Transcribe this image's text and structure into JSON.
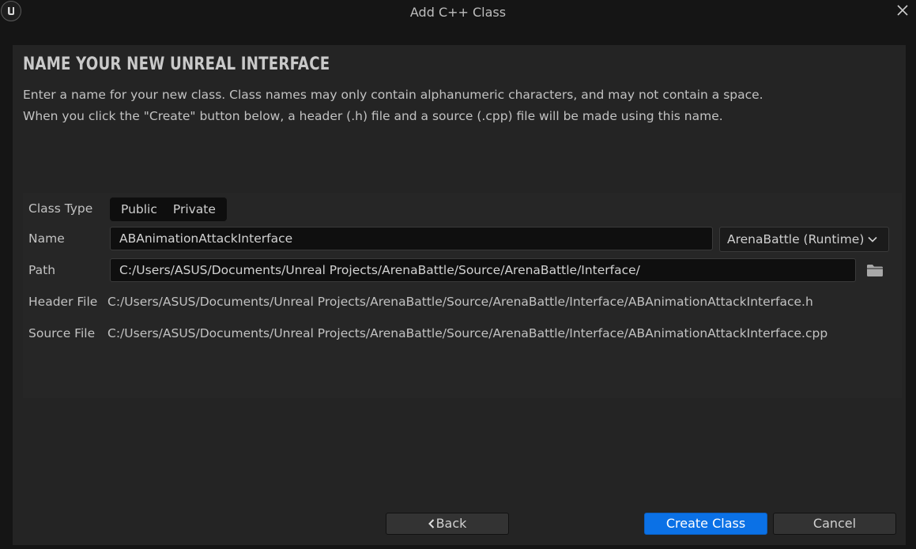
{
  "window": {
    "title": "Add C++ Class"
  },
  "header": {
    "title": "NAME YOUR NEW UNREAL INTERFACE",
    "description_line1": "Enter a name for your new class. Class names may only contain alphanumeric characters, and may not contain a space.",
    "description_line2": "When you click the \"Create\" button below, a header (.h) file and a source (.cpp) file will be made using this name."
  },
  "form": {
    "class_type_label": "Class Type",
    "class_type_options": [
      "Public",
      "Private"
    ],
    "name_label": "Name",
    "name_value": "ABAnimationAttackInterface",
    "module_selected": "ArenaBattle (Runtime)",
    "path_label": "Path",
    "path_value": "C:/Users/ASUS/Documents/Unreal Projects/ArenaBattle/Source/ArenaBattle/Interface/",
    "header_file_label": "Header File",
    "header_file_value": "C:/Users/ASUS/Documents/Unreal Projects/ArenaBattle/Source/ArenaBattle/Interface/ABAnimationAttackInterface.h",
    "source_file_label": "Source File",
    "source_file_value": "C:/Users/ASUS/Documents/Unreal Projects/ArenaBattle/Source/ArenaBattle/Interface/ABAnimationAttackInterface.cpp"
  },
  "footer": {
    "back_label": "Back",
    "create_label": "Create Class",
    "cancel_label": "Cancel"
  },
  "icons": {
    "logo": "unreal-logo-icon",
    "close": "close-icon",
    "dropdown": "chevron-down-icon",
    "folder": "folder-icon",
    "back": "chevron-left-icon"
  },
  "colors": {
    "accent": "#0b71e6",
    "background": "#151515",
    "panel": "#242424"
  }
}
